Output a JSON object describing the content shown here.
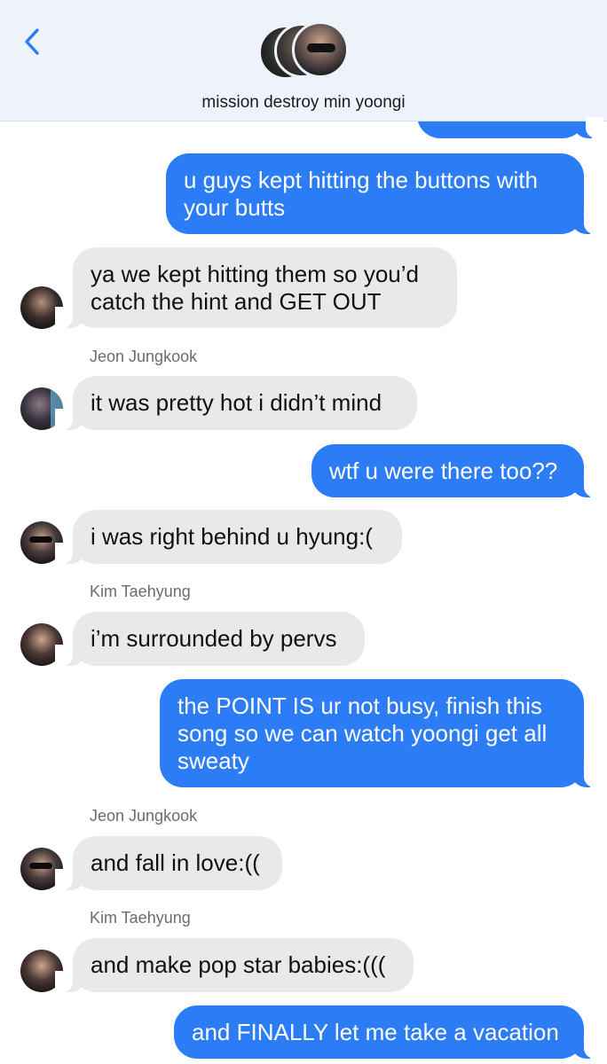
{
  "header": {
    "back_icon": "chevron-left-icon",
    "title": "mission destroy min yoongi",
    "colors": {
      "accent": "#2b7cf5",
      "header_bg": "#eef2fb"
    }
  },
  "messages": [
    {
      "text": "u guys kept hitting the buttons with your butts",
      "direction": "outgoing"
    },
    {
      "text": "ya we kept hitting them so you’d catch the hint and GET OUT",
      "direction": "incoming"
    },
    {
      "sender": "Jeon Jungkook"
    },
    {
      "text": "it was pretty hot i didn’t mind",
      "direction": "incoming"
    },
    {
      "text": "wtf u were there too??",
      "direction": "outgoing"
    },
    {
      "text": "i was right behind u hyung:(",
      "direction": "incoming"
    },
    {
      "sender": "Kim Taehyung"
    },
    {
      "text": "i’m surrounded by pervs",
      "direction": "incoming"
    },
    {
      "text": "the POINT IS ur not busy, finish this song so we can watch yoongi get all sweaty",
      "direction": "outgoing"
    },
    {
      "sender": "Jeon Jungkook"
    },
    {
      "text": "and fall in love:((",
      "direction": "incoming"
    },
    {
      "sender": "Kim Taehyung"
    },
    {
      "text": "and make pop star babies:(((",
      "direction": "incoming"
    },
    {
      "text": "and FINALLY let me take a vacation",
      "direction": "outgoing"
    }
  ]
}
